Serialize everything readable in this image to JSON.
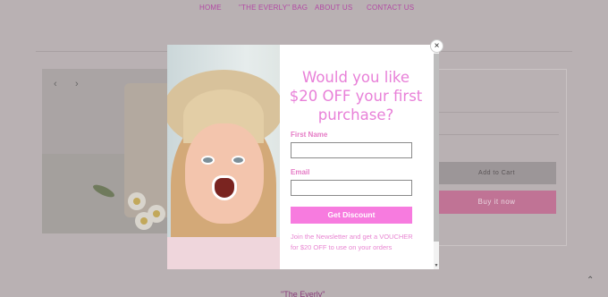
{
  "nav": {
    "items": [
      "HOME",
      "\"THE EVERLY\" BAG",
      "ABOUT US",
      "CONTACT US"
    ]
  },
  "product": {
    "add_to_cart": "Add to Cart",
    "buy_now": "Buy it now"
  },
  "footer": {
    "title": "\"The Everly\""
  },
  "icons": {
    "prev": "chevron-left-icon",
    "next": "chevron-right-icon",
    "close": "close-icon",
    "scroll_top": "chevron-up-icon"
  },
  "popup": {
    "headline": "Would you like $20 OFF your first purchase?",
    "first_name_label": "First Name",
    "first_name_value": "",
    "email_label": "Email",
    "email_value": "",
    "submit_label": "Get Discount",
    "note": "Join the Newsletter and get a VOUCHER for $20 OFF to use on your orders",
    "close_glyph": "×"
  },
  "colors": {
    "accent_pink": "#f77bdf",
    "headline_pink": "#e880d8",
    "overlay": "#b9b1b3",
    "buy_button": "#c07395"
  }
}
